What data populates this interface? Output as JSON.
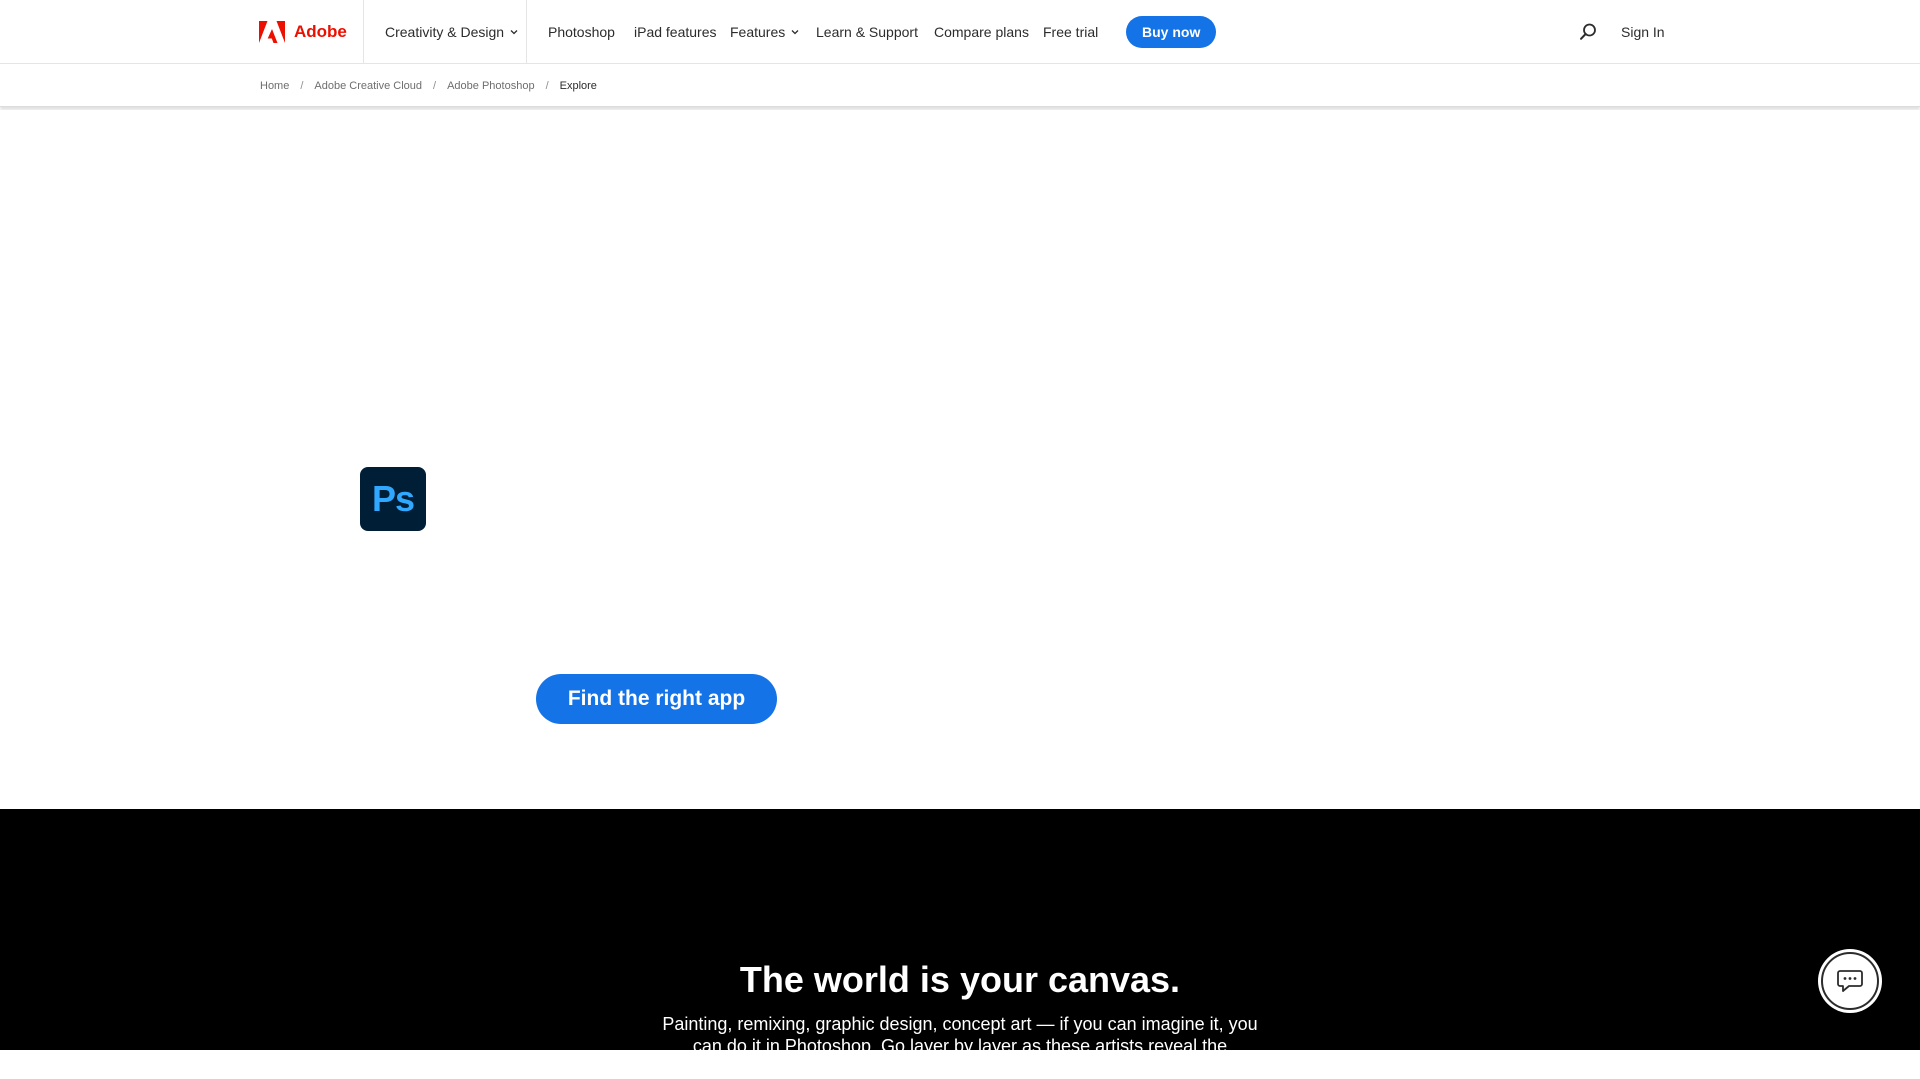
{
  "nav": {
    "brand": "Adobe",
    "creativity_design": "Creativity & Design",
    "photoshop": "Photoshop",
    "ipad_features": "iPad features",
    "features": "Features",
    "learn_support": "Learn & Support",
    "compare_plans": "Compare plans",
    "free_trial": "Free trial",
    "buy_now": "Buy now",
    "sign_in": "Sign In"
  },
  "breadcrumb": {
    "items": [
      "Home",
      "Adobe Creative Cloud",
      "Adobe Photoshop",
      "Explore"
    ],
    "separator": "/"
  },
  "hero": {
    "app_logo_text": "Ps",
    "cta_label": "Find the right app"
  },
  "canvas_section": {
    "title": "The world is your canvas.",
    "body": "Painting, remixing, graphic design, concept art — if you can imagine it, you can do it in Photoshop. Go layer by layer as these artists reveal the inspiration and"
  },
  "colors": {
    "brand_red": "#eb1000",
    "accent_blue": "#1473e6",
    "ps_dark": "#001e36",
    "ps_blue": "#31a8ff"
  },
  "icons": {
    "brand": "adobe-logo-icon",
    "search": "search-icon",
    "chevron": "chevron-down-icon",
    "chat": "chat-icon"
  }
}
